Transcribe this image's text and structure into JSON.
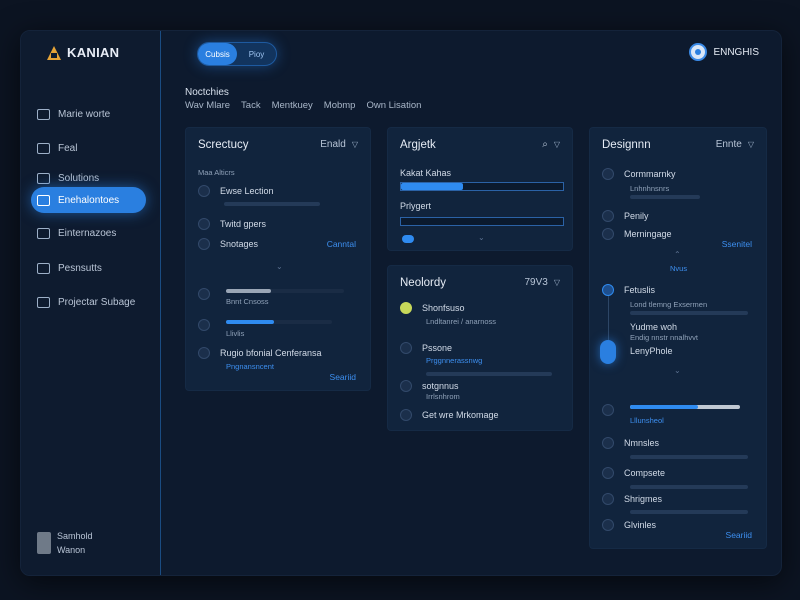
{
  "app": {
    "name": "KANIAN"
  },
  "sidebar": {
    "items": [
      {
        "label": "Marie worte",
        "icon": "home-icon"
      },
      {
        "label": "Feal",
        "icon": "document-icon"
      },
      {
        "label": "Solutions",
        "icon": "window-icon"
      },
      {
        "label": "Enehalontoes",
        "icon": "edit-icon"
      },
      {
        "label": "Einternazoes",
        "icon": "pen-icon"
      },
      {
        "label": "Pesnsutts",
        "icon": "chart-icon"
      },
      {
        "label": "Projectar Subage",
        "icon": "gear-icon"
      }
    ],
    "active_index": 3,
    "user": {
      "name": "Samhold",
      "role": "Wanon"
    }
  },
  "topbar": {
    "toggle": [
      "Cubsis",
      "Pioy"
    ],
    "profile_name": "ENNGHIS"
  },
  "main": {
    "title": "Noctchies",
    "filters": [
      "Wav Mlare",
      "Tack",
      "Mentkuey",
      "Mobmp",
      "Own Lisation"
    ]
  },
  "panel1": {
    "title": "Screctucy",
    "action": "Enald",
    "subheader": "Maa Alticrs",
    "rows": [
      {
        "label": "Ewse Lection",
        "progress": 0.0
      },
      {
        "label": "Twitd gpers"
      },
      {
        "label": "Snotages",
        "link": "Canntal"
      }
    ],
    "lower": [
      {
        "sub": "Bnnt Cnsoss",
        "progress": 0.38
      },
      {
        "sub": "Llivlis",
        "progress": 0.45
      },
      {
        "label": "Rugio bfonial Cenferansa",
        "sub": "Pngnansncent"
      }
    ],
    "footer_link": "Seariid"
  },
  "panel2": {
    "title": "Argjetk",
    "rows": [
      {
        "label": "Kakat Kahas",
        "progress": 0.38
      },
      {
        "label": "Prlygert",
        "progress": 0.0
      }
    ]
  },
  "panel3": {
    "title": "Neolordy",
    "action": "79V3",
    "rows": [
      {
        "label": "Shonfsuso",
        "sub": "Lndltanrei / anarnoss"
      },
      {
        "label": "Pssone",
        "sub": "Prggnnerassnwg"
      },
      {
        "label": "sotgnnus",
        "sub": "Irrlsnhrom"
      },
      {
        "label": "Get wre Mrkomage"
      }
    ]
  },
  "panel4": {
    "title": "Designnn",
    "action": "Ennte",
    "rows": [
      {
        "label": "Cormmarnky",
        "sub": "Lnhnhnsnrs"
      },
      {
        "label": "Penily"
      },
      {
        "label": "Merningage",
        "link": "Ssenitel"
      },
      {
        "label": "Fetuslis",
        "sub": "Lond tlemng Exsermen"
      },
      {
        "label": "Yudme woh",
        "sub": "Endig nnstr nnalhvvt"
      },
      {
        "label": "LenyPhole"
      },
      {
        "label": "Lllunsheol",
        "progress": 0.62
      },
      {
        "label": "Nmnsles"
      },
      {
        "label": "Compsete"
      },
      {
        "label": "Shrigmes"
      },
      {
        "label": "Glvinles"
      }
    ],
    "mid_link": "Nvus",
    "footer_link": "Seariid"
  },
  "colors": {
    "accent": "#2a7fe0",
    "background": "#0d1a2e",
    "panel": "#11243d"
  }
}
